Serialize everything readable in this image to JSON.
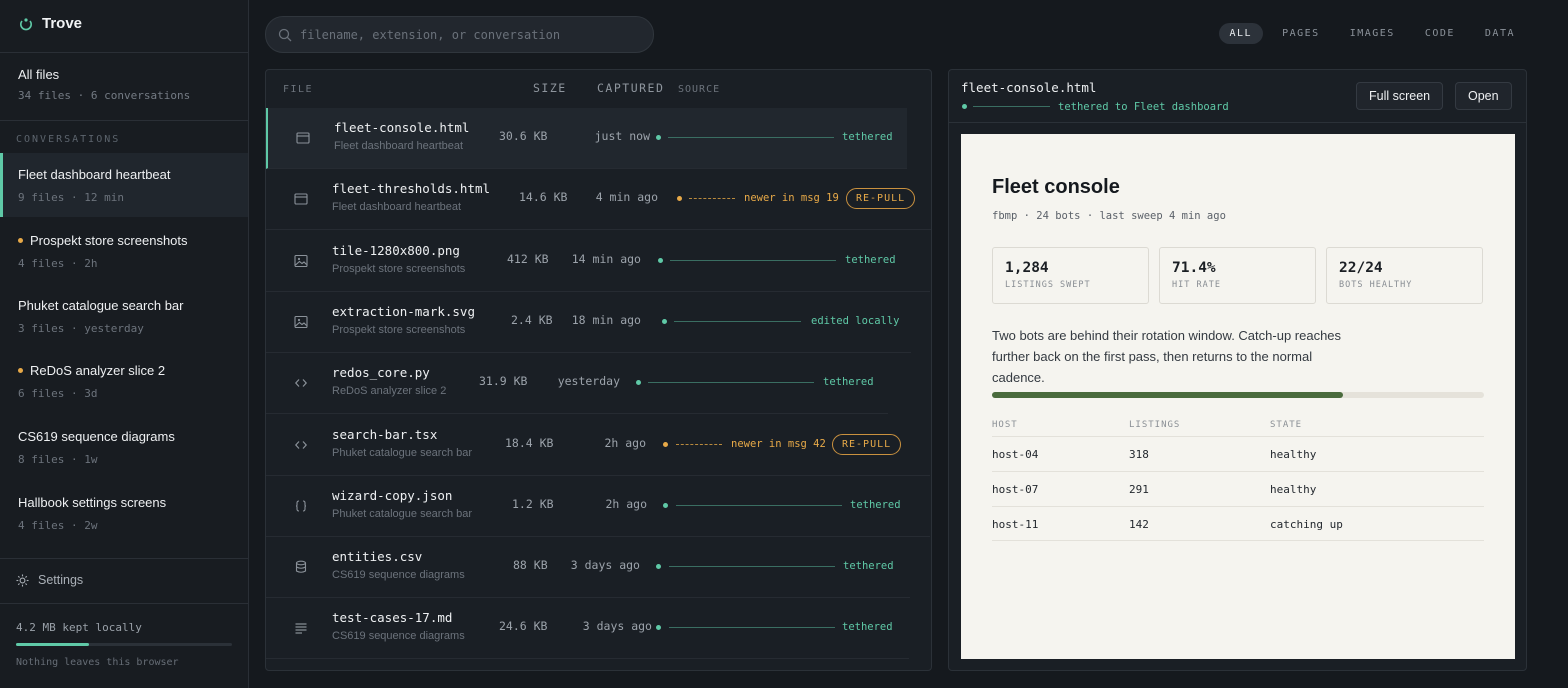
{
  "app": {
    "name": "Trove"
  },
  "sidebar": {
    "all_files": {
      "label": "All files",
      "sub": "34 files · 6 conversations"
    },
    "conversations_header": "CONVERSATIONS",
    "conversations": [
      {
        "label": "Fleet dashboard heartbeat",
        "sub": "9 files · 12 min",
        "active": true,
        "dot": false
      },
      {
        "label": "Prospekt store screenshots",
        "sub": "4 files · 2h",
        "active": false,
        "dot": true
      },
      {
        "label": "Phuket catalogue search bar",
        "sub": "3 files · yesterday",
        "active": false,
        "dot": false
      },
      {
        "label": "ReDoS analyzer slice 2",
        "sub": "6 files · 3d",
        "active": false,
        "dot": true
      },
      {
        "label": "CS619 sequence diagrams",
        "sub": "8 files · 1w",
        "active": false,
        "dot": false
      },
      {
        "label": "Hallbook settings screens",
        "sub": "4 files · 2w",
        "active": false,
        "dot": false
      }
    ],
    "settings_label": "Settings",
    "storage": {
      "label": "4.2 MB kept locally",
      "note": "Nothing leaves this browser",
      "fraction": 0.34
    }
  },
  "search": {
    "placeholder": "filename, extension, or conversation"
  },
  "filters": [
    "ALL",
    "PAGES",
    "IMAGES",
    "CODE",
    "DATA"
  ],
  "active_filter": "ALL",
  "file_table": {
    "headers": {
      "file": "FILE",
      "size": "SIZE",
      "captured": "CAPTURED",
      "source": "SOURCE"
    },
    "rows": [
      {
        "name": "fleet-console.html",
        "conversation": "Fleet dashboard heartbeat",
        "size": "30.6 KB",
        "captured": "just now",
        "status": "tethered",
        "kind": "ok",
        "icon": "page-icon"
      },
      {
        "name": "fleet-thresholds.html",
        "conversation": "Fleet dashboard heartbeat",
        "size": "14.6 KB",
        "captured": "4 min ago",
        "status": "newer in msg 19",
        "kind": "warn",
        "action": "RE-PULL",
        "icon": "page-icon"
      },
      {
        "name": "tile-1280x800.png",
        "conversation": "Prospekt store screenshots",
        "size": "412 KB",
        "captured": "14 min ago",
        "status": "tethered",
        "kind": "ok",
        "icon": "image-icon"
      },
      {
        "name": "extraction-mark.svg",
        "conversation": "Prospekt store screenshots",
        "size": "2.4 KB",
        "captured": "18 min ago",
        "status": "edited locally",
        "kind": "ok",
        "icon": "image-icon"
      },
      {
        "name": "redos_core.py",
        "conversation": "ReDoS analyzer slice 2",
        "size": "31.9 KB",
        "captured": "yesterday",
        "status": "tethered",
        "kind": "ok",
        "icon": "code-icon"
      },
      {
        "name": "search-bar.tsx",
        "conversation": "Phuket catalogue search bar",
        "size": "18.4 KB",
        "captured": "2h ago",
        "status": "newer in msg 42",
        "kind": "warn",
        "action": "RE-PULL",
        "icon": "code-icon"
      },
      {
        "name": "wizard-copy.json",
        "conversation": "Phuket catalogue search bar",
        "size": "1.2 KB",
        "captured": "2h ago",
        "status": "tethered",
        "kind": "ok",
        "icon": "json-icon"
      },
      {
        "name": "entities.csv",
        "conversation": "CS619 sequence diagrams",
        "size": "88 KB",
        "captured": "3 days ago",
        "status": "tethered",
        "kind": "ok",
        "icon": "database-icon"
      },
      {
        "name": "test-cases-17.md",
        "conversation": "CS619 sequence diagrams",
        "size": "24.6 KB",
        "captured": "3 days ago",
        "status": "tethered",
        "kind": "ok",
        "icon": "text-icon"
      }
    ]
  },
  "preview": {
    "filename": "fleet-console.html",
    "tether_label": "tethered to Fleet dashboard",
    "buttons": {
      "fullscreen": "Full screen",
      "open": "Open"
    },
    "doc": {
      "title": "Fleet console",
      "meta": "fbmp · 24 bots · last sweep 4 min ago",
      "stats": [
        {
          "value": "1,284",
          "label": "LISTINGS SWEPT"
        },
        {
          "value": "71.4%",
          "label": "HIT RATE"
        },
        {
          "value": "22/24",
          "label": "BOTS HEALTHY"
        }
      ],
      "paragraph": "Two bots are behind their rotation window. Catch-up reaches further back on the first pass, then returns to the normal cadence.",
      "progress": 0.714,
      "table": {
        "headers": [
          "HOST",
          "LISTINGS",
          "STATE"
        ],
        "rows": [
          [
            "host-04",
            "318",
            "healthy"
          ],
          [
            "host-07",
            "291",
            "healthy"
          ],
          [
            "host-11",
            "142",
            "catching up"
          ]
        ]
      }
    }
  }
}
